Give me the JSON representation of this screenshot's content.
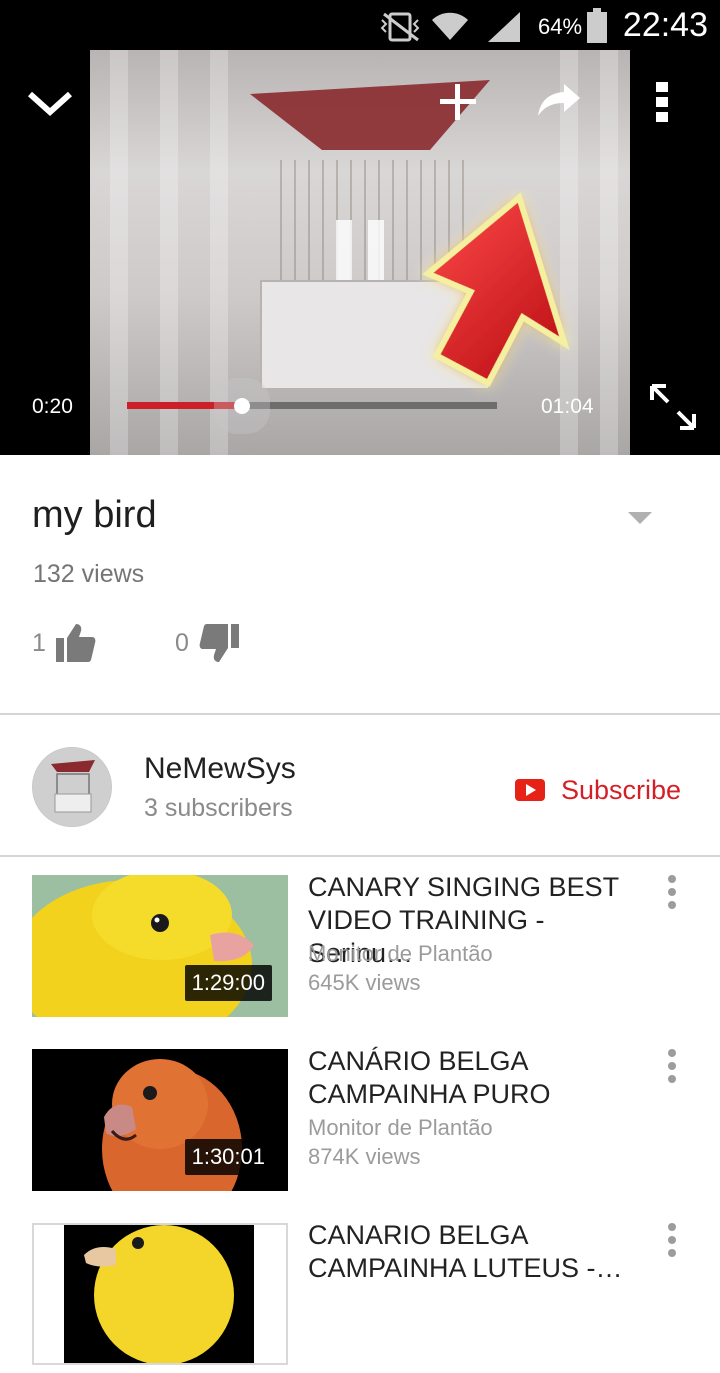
{
  "status_bar": {
    "time": "22:43",
    "battery_percent": "64%",
    "icons": [
      "mute-vibrate-icon",
      "wifi-icon",
      "signal-icon",
      "battery-icon"
    ]
  },
  "player": {
    "current_time": "0:20",
    "duration": "01:04",
    "progress_fraction": 0.31,
    "icons": [
      "minimize-chevron-icon",
      "add-to-playlist-icon",
      "share-icon",
      "more-vert-icon",
      "pause-icon",
      "fullscreen-icon"
    ]
  },
  "video": {
    "title": "my bird",
    "views": "132 views",
    "likes": "1",
    "dislikes": "0"
  },
  "channel": {
    "name": "NeMewSys",
    "subscribers": "3 subscribers",
    "subscribe_label": "Subscribe"
  },
  "related": [
    {
      "title": "CANARY SINGING BEST VIDEO TRAINING - Serinu…",
      "channel": "Monitor de Plantão",
      "views": "645K views",
      "duration": "1:29:00"
    },
    {
      "title": "CANÁRIO BELGA CAMPAINHA PURO",
      "channel": "Monitor de Plantão",
      "views": "874K views",
      "duration": "1:30:01"
    },
    {
      "title": "CANARIO BELGA CAMPAINHA LUTEUS -…",
      "channel": "",
      "views": "",
      "duration": ""
    }
  ],
  "colors": {
    "accent_red": "#d51f26",
    "progress_red": "#cc1f27"
  }
}
